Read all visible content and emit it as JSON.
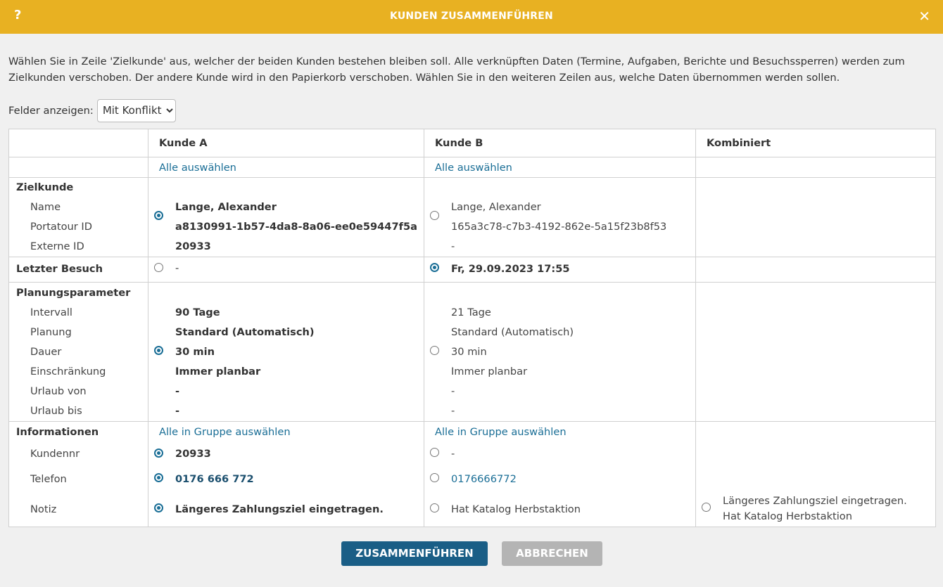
{
  "dialog": {
    "title": "KUNDEN ZUSAMMENFÜHREN",
    "help": "?",
    "close": "✕"
  },
  "description": "Wählen Sie in Zeile 'Zielkunde' aus, welcher der beiden Kunden bestehen bleiben soll. Alle verknüpften Daten (Termine, Aufgaben, Berichte und Besuchssperren) werden zum Zielkunden verschoben. Der andere Kunde wird in den Papierkorb verschoben. Wählen Sie in den weiteren Zeilen aus, welche Daten übernommen werden sollen.",
  "filter": {
    "label": "Felder anzeigen:",
    "value": "Mit Konflikt"
  },
  "columns": {
    "a": "Kunde A",
    "b": "Kunde B",
    "combined": "Kombiniert"
  },
  "select_all": "Alle auswählen",
  "select_group": "Alle in Gruppe auswählen",
  "zielkunde": {
    "title": "Zielkunde",
    "labels": [
      "Name",
      "Portatour ID",
      "Externe ID"
    ],
    "a": [
      "Lange, Alexander",
      "a8130991-1b57-4da8-8a06-ee0e59447f5a",
      "20933"
    ],
    "b": [
      "Lange, Alexander",
      "165a3c78-c7b3-4192-862e-5a15f23b8f53",
      "-"
    ]
  },
  "letzter_besuch": {
    "title": "Letzter Besuch",
    "a": "-",
    "b": "Fr, 29.09.2023 17:55"
  },
  "planung": {
    "title": "Planungsparameter",
    "labels": [
      "Intervall",
      "Planung",
      "Dauer",
      "Einschränkung",
      "Urlaub von",
      "Urlaub bis"
    ],
    "a": [
      "90 Tage",
      "Standard (Automatisch)",
      "30 min",
      "Immer planbar",
      "-",
      "-"
    ],
    "b": [
      "21 Tage",
      "Standard (Automatisch)",
      "30 min",
      "Immer planbar",
      "-",
      "-"
    ]
  },
  "informationen": {
    "title": "Informationen",
    "labels": [
      "Kundennr",
      "Telefon",
      "Notiz"
    ],
    "a": [
      "20933",
      "0176 666 772",
      "Längeres Zahlungsziel eingetragen."
    ],
    "b": [
      "-",
      "0176666772",
      "Hat Katalog Herbstaktion"
    ],
    "combined_note": [
      "Längeres Zahlungsziel eingetragen.",
      "Hat Katalog Herbstaktion"
    ]
  },
  "buttons": {
    "merge": "ZUSAMMENFÜHREN",
    "cancel": "ABBRECHEN"
  },
  "colors": {
    "header": "#e8b122",
    "accent": "#1a6e96",
    "primary_button": "#1a5e86",
    "disabled_button": "#b4b4b4"
  }
}
